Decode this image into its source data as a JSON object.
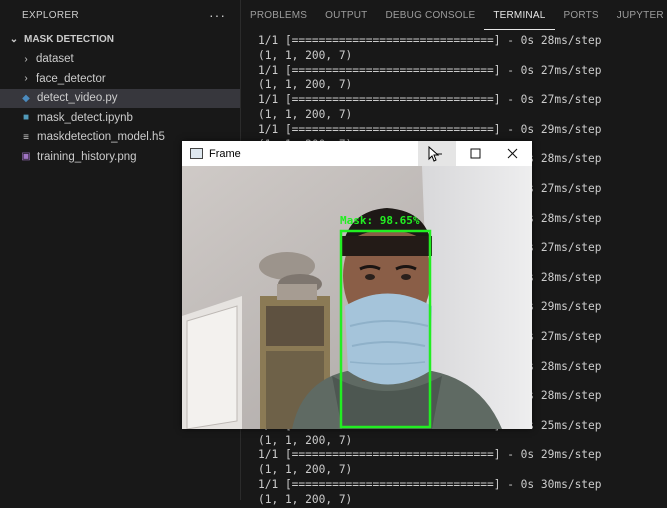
{
  "explorer": {
    "title": "EXPLORER",
    "more": "···",
    "section": "MASK DETECTION",
    "items": [
      {
        "label": "dataset",
        "type": "folder",
        "icon": "chevron-right-icon"
      },
      {
        "label": "face_detector",
        "type": "folder",
        "icon": "chevron-right-icon"
      },
      {
        "label": "detect_video.py",
        "type": "python",
        "icon": "python-file-icon",
        "selected": true
      },
      {
        "label": "mask_detect.ipynb",
        "type": "notebook",
        "icon": "notebook-file-icon"
      },
      {
        "label": "maskdetection_model.h5",
        "type": "data",
        "icon": "data-file-icon"
      },
      {
        "label": "training_history.png",
        "type": "image",
        "icon": "image-file-icon"
      }
    ]
  },
  "panel": {
    "tabs": [
      "PROBLEMS",
      "OUTPUT",
      "DEBUG CONSOLE",
      "TERMINAL",
      "PORTS",
      "JUPYTER"
    ],
    "active_tab": "TERMINAL"
  },
  "terminal": {
    "lines": [
      "1/1 [==============================] - 0s 28ms/step",
      "(1, 1, 200, 7)",
      "1/1 [==============================] - 0s 27ms/step",
      "(1, 1, 200, 7)",
      "1/1 [==============================] - 0s 27ms/step",
      "(1, 1, 200, 7)",
      "1/1 [==============================] - 0s 29ms/step",
      "(1, 1, 200, 7)",
      "1/1 [==============================] - 0s 28ms/step",
      "(1, 1, 200, 7)",
      "1/1 [==============================] - 0s 27ms/step",
      "(1, 1, 200, 7)",
      "1/1 [==============================] - 0s 28ms/step",
      "(1, 1, 200, 7)",
      "1/1 [==============================] - 0s 27ms/step",
      "(1, 1, 200, 7)",
      "1/1 [==============================] - 0s 28ms/step",
      "(1, 1, 200, 7)",
      "1/1 [==============================] - 0s 29ms/step",
      "(1, 1, 200, 7)",
      "1/1 [==============================] - 0s 27ms/step",
      "(1, 1, 200, 7)",
      "1/1 [==============================] - 0s 28ms/step",
      "(1, 1, 200, 7)",
      "1/1 [==============================] - 0s 28ms/step",
      "(1, 1, 200, 7)",
      "1/1 [==============================] - 0s 25ms/step",
      "(1, 1, 200, 7)",
      "1/1 [==============================] - 0s 29ms/step",
      "(1, 1, 200, 7)",
      "1/1 [==============================] - 0s 30ms/step",
      "(1, 1, 200, 7)"
    ]
  },
  "frame_window": {
    "title": "Frame",
    "detection_label": "Mask: 98.65%",
    "box_color": "#22ee22"
  }
}
